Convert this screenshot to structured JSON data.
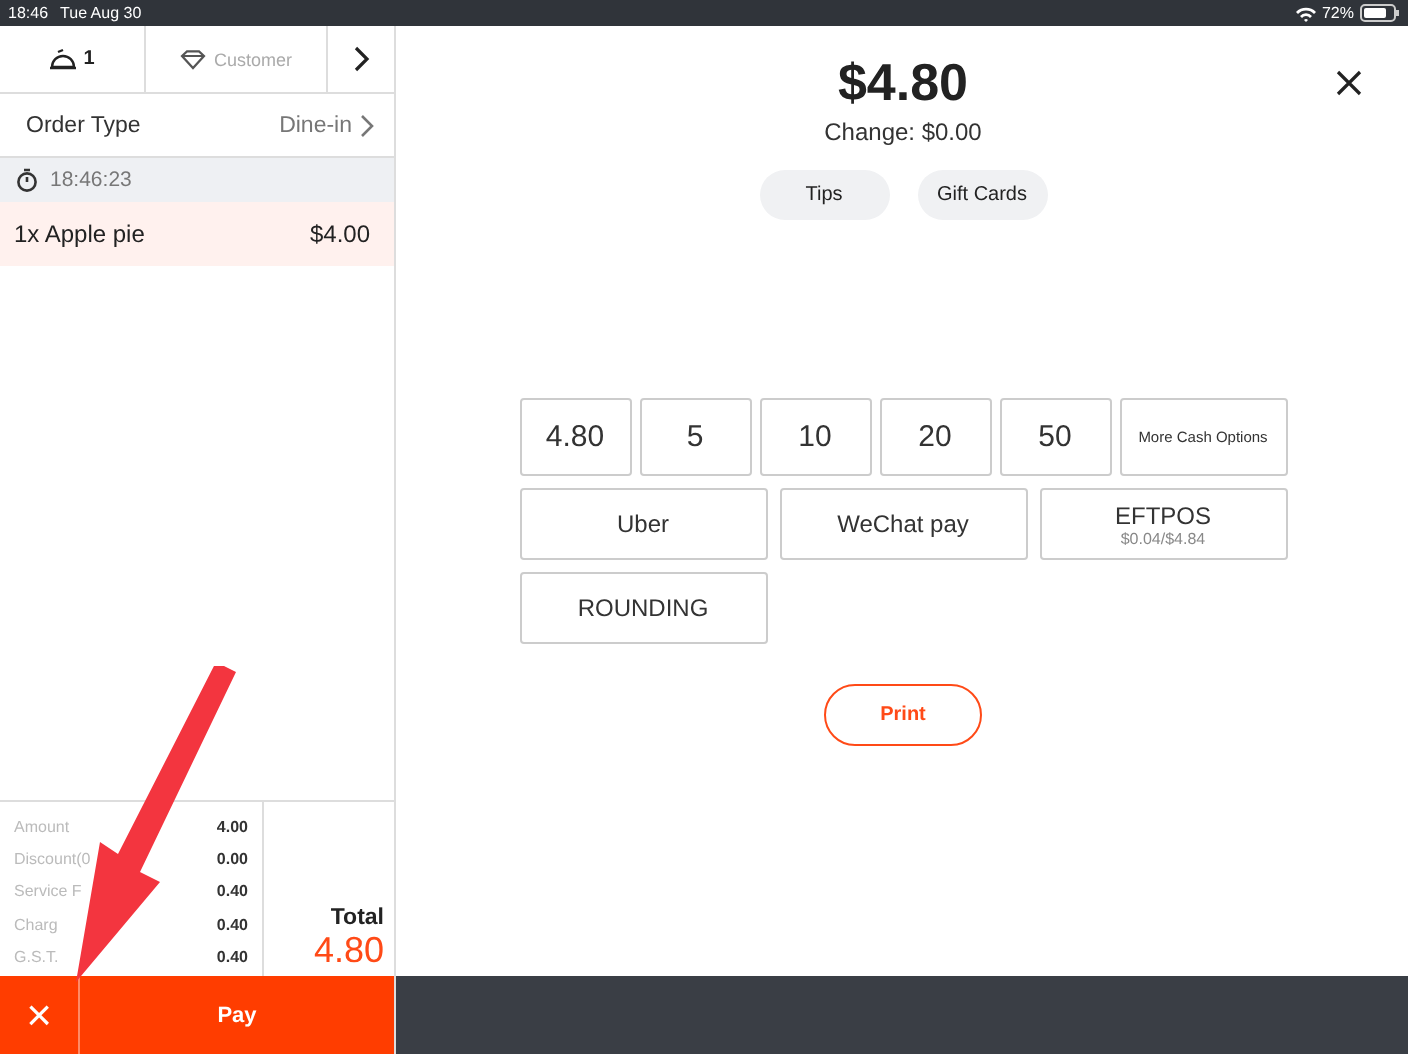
{
  "status_bar": {
    "time": "18:46",
    "date": "Tue Aug 30",
    "battery": "72%"
  },
  "order_panel": {
    "table_number": "1",
    "customer_placeholder": "Customer",
    "order_type": {
      "label": "Order Type",
      "value": "Dine-in"
    },
    "timer": "18:46:23",
    "items": [
      {
        "name": "1x Apple pie",
        "price": "$4.00",
        "selected": true
      }
    ],
    "summary": [
      {
        "label": "Amount",
        "value": "4.00"
      },
      {
        "label": "Discount(0",
        "value": "0.00"
      },
      {
        "label": "Service F",
        "value": "0.40"
      },
      {
        "label": "Charg",
        "value": "0.40"
      },
      {
        "label": "G.S.T.",
        "value": "0.40"
      }
    ],
    "total": {
      "label": "Total",
      "value": "4.80"
    },
    "cancel_button": "×",
    "pay_button": "Pay"
  },
  "payment": {
    "amount": "$4.80",
    "change": "Change: $0.00",
    "extras": [
      "Tips",
      "Gift Cards"
    ],
    "cash_options": [
      {
        "label": "4.80",
        "kind": "large"
      },
      {
        "label": "5",
        "kind": "large"
      },
      {
        "label": "10",
        "kind": "large"
      },
      {
        "label": "20",
        "kind": "large"
      },
      {
        "label": "50",
        "kind": "large"
      },
      {
        "label": "More Cash Options",
        "kind": "small"
      }
    ],
    "methods": [
      {
        "label": "Uber"
      },
      {
        "label": "WeChat pay"
      },
      {
        "label": "EFTPOS",
        "sub": "$0.04/$4.84"
      },
      {
        "label": "ROUNDING"
      }
    ],
    "print_button": "Print"
  }
}
